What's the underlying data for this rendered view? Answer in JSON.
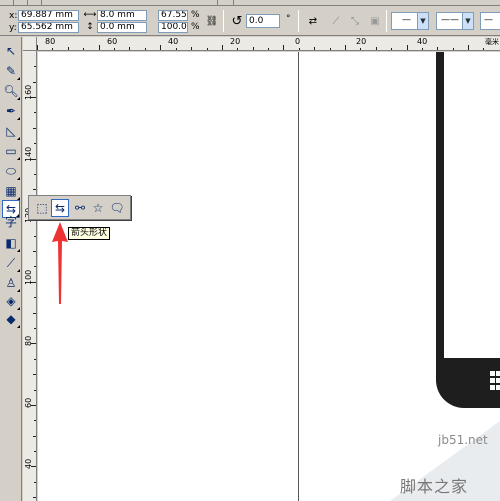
{
  "propbar": {
    "x_label": "x:",
    "x_value": "69.887 mm",
    "y_label": "y:",
    "y_value": "65.562 mm",
    "w_value": "8.0 mm",
    "h_value": "0.0 mm",
    "scale_x": "67.55",
    "scale_y": "100.0",
    "percent_x": "%",
    "percent_y": "%",
    "rotation": "0.0",
    "degree": "°",
    "line_style_preview": "—",
    "line_width_preview": "——"
  },
  "rulers": {
    "h_ticks": [
      "80",
      "60",
      "40",
      "20",
      "0",
      "20",
      "40"
    ],
    "v_ticks": [
      "160",
      "140",
      "120",
      "100",
      "80",
      "60",
      "40"
    ],
    "unit_label": "毫米"
  },
  "flyout": {
    "tools": [
      {
        "name": "basic-shapes-tool",
        "icon": "basic-shapes-icon"
      },
      {
        "name": "arrow-shapes-tool",
        "icon": "arrow-shapes-icon"
      },
      {
        "name": "flowchart-shapes-tool",
        "icon": "flowchart-icon"
      },
      {
        "name": "star-shapes-tool",
        "icon": "star-icon"
      },
      {
        "name": "callout-shapes-tool",
        "icon": "callout-icon"
      }
    ],
    "tooltip": "箭头形状"
  },
  "watermark": {
    "site": "jb51.net",
    "name": "脚本之家"
  },
  "colors": {
    "accent": "#316ac5",
    "arrow": "#ee3333",
    "shape_fill": "#1e1e1e"
  }
}
